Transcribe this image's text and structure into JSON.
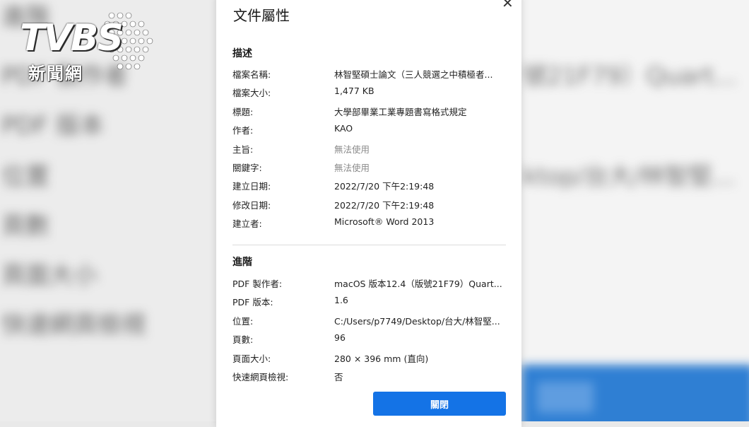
{
  "dialog": {
    "title": "文件屬性",
    "close_icon": "close-icon",
    "description_header": "描述",
    "description_rows": [
      {
        "key": "檔案名稱:",
        "value": "林智堅碩士論文（三人競選之中積極者...",
        "muted": false
      },
      {
        "key": "檔案大小:",
        "value": "1,477 KB",
        "muted": false
      },
      {
        "key": "標題:",
        "value": "大學部畢業工業專題書寫格式規定",
        "muted": false
      },
      {
        "key": "作者:",
        "value": "KAO",
        "muted": false
      },
      {
        "key": "主旨:",
        "value": "無法使用",
        "muted": true
      },
      {
        "key": "關鍵字:",
        "value": "無法使用",
        "muted": true
      },
      {
        "key": "建立日期:",
        "value": "2022/7/20 下午2:19:48",
        "muted": false
      },
      {
        "key": "修改日期:",
        "value": "2022/7/20 下午2:19:48",
        "muted": false
      },
      {
        "key": "建立者:",
        "value": "Microsoft® Word 2013",
        "muted": false
      }
    ],
    "advanced_header": "進階",
    "advanced_rows": [
      {
        "key": "PDF 製作者:",
        "value": "macOS 版本12.4（版號21F79）Quart...",
        "muted": false
      },
      {
        "key": "PDF 版本:",
        "value": "1.6",
        "muted": false
      },
      {
        "key": "位置:",
        "value": "C:/Users/p7749/Desktop/台大/林智堅...",
        "muted": false
      },
      {
        "key": "頁數:",
        "value": "96",
        "muted": false
      },
      {
        "key": "頁面大小:",
        "value": "280 × 396 mm (直向)",
        "muted": false
      },
      {
        "key": "快速網頁檢視:",
        "value": "否",
        "muted": false
      }
    ],
    "close_button": "關閉",
    "accent_color": "#1473e6"
  },
  "logo": {
    "text": "TVBS",
    "subtext": "新聞網"
  },
  "background": {
    "left_words": [
      "進階",
      "PDF 製作者",
      "PDF 版本",
      "位置",
      "頁數",
      "頁面大小",
      "快速網頁檢視"
    ],
    "right_words": [
      "號21F79）Quart...",
      "ktop/台大/林智堅..."
    ]
  }
}
